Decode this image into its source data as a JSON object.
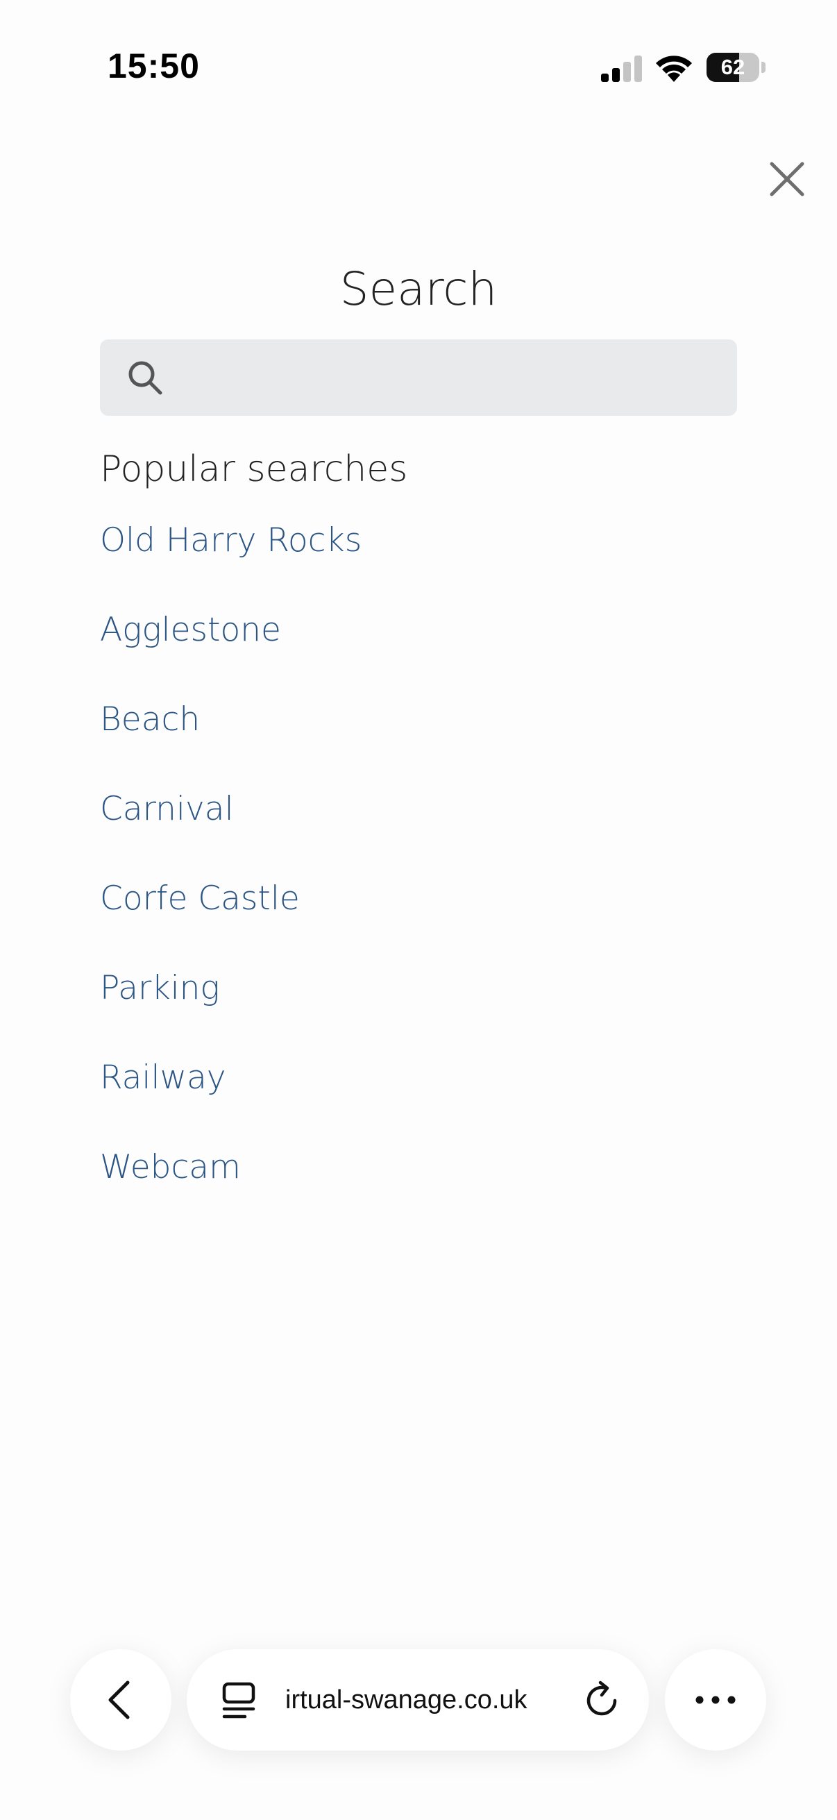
{
  "status_bar": {
    "time": "15:50",
    "battery_percent": "62",
    "battery_level": 0.62,
    "signal_bars_active": 2,
    "signal_bars_total": 4
  },
  "close": {
    "icon": "close-icon"
  },
  "title": "Search",
  "search": {
    "placeholder": "",
    "value": "",
    "icon": "search-icon"
  },
  "popular": {
    "heading": "Popular searches",
    "items": [
      {
        "label": "Old Harry Rocks"
      },
      {
        "label": "Agglestone"
      },
      {
        "label": "Beach"
      },
      {
        "label": "Carnival"
      },
      {
        "label": "Corfe Castle"
      },
      {
        "label": "Parking"
      },
      {
        "label": "Railway"
      },
      {
        "label": "Webcam"
      }
    ]
  },
  "browser": {
    "url": "irtual-swanage.co.uk",
    "back_icon": "chevron-left-icon",
    "tabs_icon": "tabs-icon",
    "reload_icon": "reload-icon",
    "more_icon": "more-icon"
  },
  "colors": {
    "link": "#2b5584",
    "search_bg": "#e9eaec",
    "text": "#222222"
  }
}
